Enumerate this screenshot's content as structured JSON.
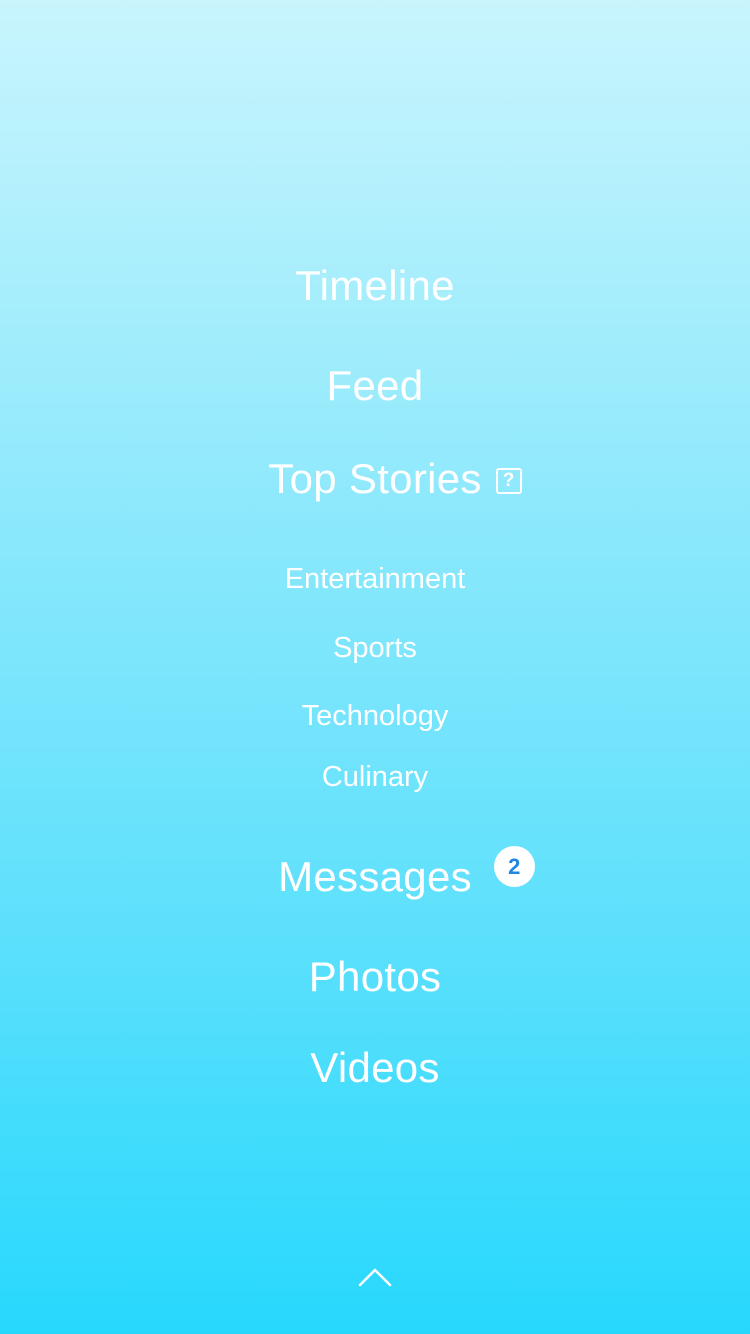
{
  "menu": {
    "items": [
      {
        "label": "Timeline"
      },
      {
        "label": "Feed"
      },
      {
        "label": "Top Stories",
        "icon": "help-icon"
      },
      {
        "label": "Entertainment"
      },
      {
        "label": "Sports"
      },
      {
        "label": "Technology"
      },
      {
        "label": "Culinary"
      },
      {
        "label": "Messages",
        "badge": "2"
      },
      {
        "label": "Photos"
      },
      {
        "label": "Videos"
      }
    ],
    "collapse_icon": "chevron-up-icon"
  },
  "colors": {
    "background_top": "#c9f5fd",
    "background_bottom": "#27d8fd",
    "text": "#ffffff",
    "badge_text": "#1f86e3"
  }
}
